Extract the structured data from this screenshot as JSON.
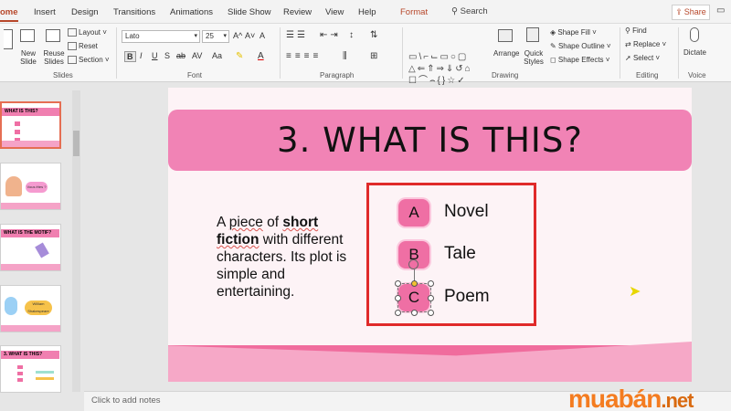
{
  "tabs": [
    {
      "label": "ome",
      "active": true
    },
    {
      "label": "Insert"
    },
    {
      "label": "Design"
    },
    {
      "label": "Transitions"
    },
    {
      "label": "Animations"
    },
    {
      "label": "Slide Show"
    },
    {
      "label": "Review"
    },
    {
      "label": "View"
    },
    {
      "label": "Help"
    },
    {
      "label": "Format",
      "accent": "#b7472a"
    }
  ],
  "search": {
    "label": "Search"
  },
  "share": {
    "label": "Share"
  },
  "ribbon": {
    "slides": {
      "new_slide": "New Slide",
      "reuse_slides": "Reuse Slides",
      "layout": "Layout",
      "reset": "Reset",
      "section": "Section",
      "group_label": "Slides"
    },
    "font": {
      "family": "Lato",
      "size": "25",
      "group_label": "Font",
      "bold": "B",
      "italic": "I",
      "underline": "U",
      "strike": "S",
      "shadow": "ab",
      "spacing": "AV",
      "case": "Aa",
      "grow": "A^",
      "shrink": "A˅",
      "clear": "A"
    },
    "paragraph": {
      "group_label": "Paragraph"
    },
    "drawing": {
      "shape_fill": "Shape Fill",
      "shape_outline": "Shape Outline",
      "shape_effects": "Shape Effects",
      "arrange": "Arrange",
      "quick_styles": "Quick Styles",
      "group_label": "Drawing"
    },
    "editing": {
      "find": "Find",
      "replace": "Replace",
      "select": "Select",
      "group_label": "Editing"
    },
    "voice": {
      "dictate": "Dictate",
      "group_label": "Voice"
    }
  },
  "thumbnails": [
    {
      "title": "WHAT IS THIS?",
      "selected": true
    },
    {
      "title": "",
      "badge": "Vous êtes ?"
    },
    {
      "title": "WHAT IS THE MOTIF?"
    },
    {
      "title": "",
      "badge": "William Shakespeare"
    },
    {
      "title": "3. WHAT IS THIS?"
    }
  ],
  "slide": {
    "title": "3. WHAT IS THIS?",
    "description_parts": {
      "p1": "A ",
      "p2": "piece",
      "p3": " of ",
      "p4": "short fiction",
      "p5": " with different characters. Its plot is simple and entertaining."
    },
    "options": [
      {
        "letter": "A",
        "label": "Novel"
      },
      {
        "letter": "B",
        "label": "Tale"
      },
      {
        "letter": "C",
        "label": "Poem"
      }
    ],
    "colors": {
      "title_band": "#f183b5",
      "option_badge": "#ef6fa4",
      "highlight_box": "#e02a2a"
    }
  },
  "notes": {
    "placeholder": "Click to add notes"
  },
  "watermark": {
    "brand": "muabán",
    "tld": ".net"
  }
}
